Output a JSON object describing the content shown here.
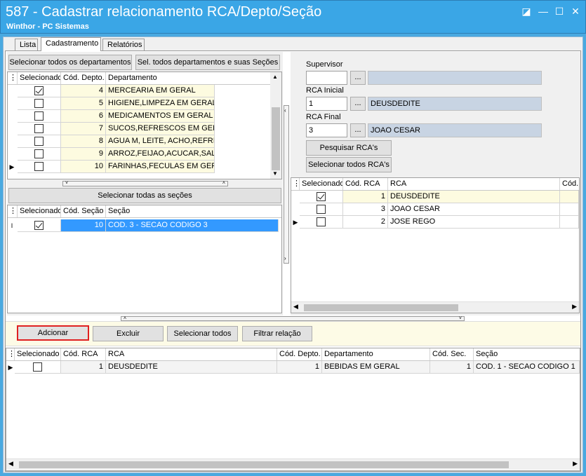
{
  "window": {
    "title": "587 - Cadastrar relacionamento RCA/Depto/Seção",
    "subtitle": "Winthor - PC Sistemas",
    "controls": {
      "restore": "◪",
      "minimize": "—",
      "maximize": "☐",
      "close": "✕"
    }
  },
  "tabs": [
    {
      "label": "Lista"
    },
    {
      "label": "Cadastramento"
    },
    {
      "label": "Relatórios"
    }
  ],
  "dept_panel": {
    "btn_select_all_depts": "Selecionar todos os departamentos",
    "btn_select_all_depts_sections": "Sel. todos departamentos e suas Seções",
    "columns": [
      "Selecionado",
      "Cód. Depto.",
      "Departamento"
    ],
    "rows": [
      {
        "checked": true,
        "code": "4",
        "name": "MERCEARIA EM GERAL",
        "current": false
      },
      {
        "checked": false,
        "code": "5",
        "name": "HIGIENE,LIMPEZA EM GERAL",
        "current": false
      },
      {
        "checked": false,
        "code": "6",
        "name": "MEDICAMENTOS EM GERAL",
        "current": false
      },
      {
        "checked": false,
        "code": "7",
        "name": "SUCOS,REFRESCOS EM GERAL",
        "current": false
      },
      {
        "checked": false,
        "code": "8",
        "name": "AGUA M, LEITE, ACHO,REFRI",
        "current": false
      },
      {
        "checked": false,
        "code": "9",
        "name": "ARROZ,FEIJAO,ACUCAR,SAL",
        "current": false
      },
      {
        "checked": false,
        "code": "10",
        "name": "FARINHAS,FECULAS EM GERAL",
        "current": true
      }
    ]
  },
  "section_panel": {
    "btn_select_all_sections": "Selecionar todas as seções",
    "columns": [
      "Selecionado",
      "Cód. Seção",
      "Seção"
    ],
    "rows": [
      {
        "checked": true,
        "code": "10",
        "name": "COD. 3 - SECAO CODIGO 3"
      }
    ]
  },
  "rca_panel": {
    "supervisor_label": "Supervisor",
    "supervisor_value": "",
    "supervisor_desc": "",
    "rca_inicial_label": "RCA Inicial",
    "rca_inicial_value": "1",
    "rca_inicial_desc": "DEUSDEDITE",
    "rca_final_label": "RCA Final",
    "rca_final_value": "3",
    "rca_final_desc": "JOAO CESAR",
    "lookup_label": "...",
    "btn_search": "Pesquisar RCA's",
    "btn_select_all": "Selecionar todos RCA's",
    "columns": [
      "Selecionado",
      "Cód. RCA",
      "RCA",
      "Cód."
    ],
    "rows": [
      {
        "checked": true,
        "code": "1",
        "name": "DEUSDEDITE",
        "current": false
      },
      {
        "checked": false,
        "code": "3",
        "name": "JOAO CESAR",
        "current": false
      },
      {
        "checked": false,
        "code": "2",
        "name": "JOSE REGO",
        "current": true
      }
    ]
  },
  "action_bar": {
    "add": "Adcionar",
    "delete": "Excluir",
    "select_all": "Selecionar todos",
    "filter": "Filtrar relação"
  },
  "result_grid": {
    "columns": [
      "Selecionado",
      "Cód. RCA",
      "RCA",
      "Cód. Depto.",
      "Departamento",
      "Cód. Sec.",
      "Seção"
    ],
    "rows": [
      {
        "checked": false,
        "rca_code": "1",
        "rca": "DEUSDEDITE",
        "dept_code": "1",
        "dept": "BEBIDAS EM GERAL",
        "sec_code": "1",
        "section": "COD. 1 - SECAO CODIGO 1"
      }
    ]
  },
  "colors": {
    "titlebar": "#3aa6e6",
    "selection": "#3399ff",
    "highlight_border": "#e02020"
  }
}
